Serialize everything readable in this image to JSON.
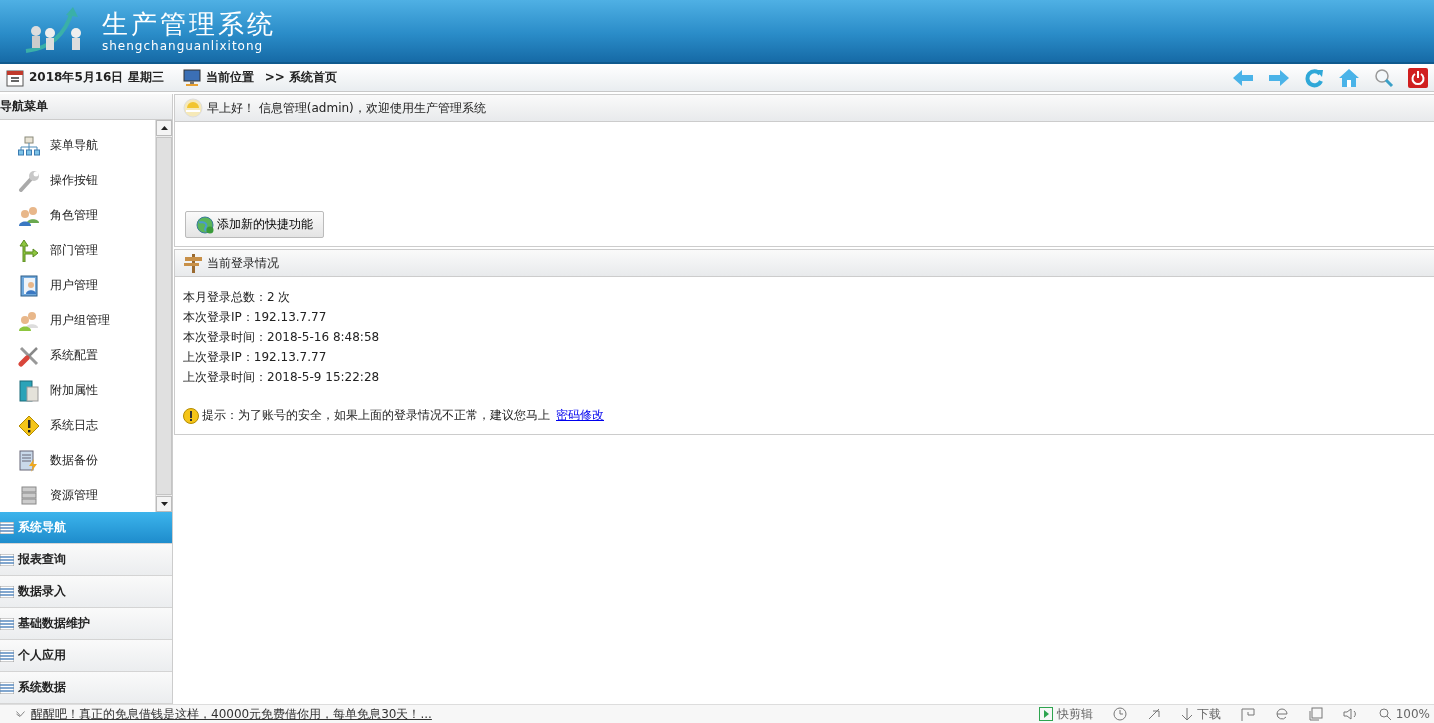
{
  "header": {
    "title": "生产管理系统",
    "subtitle": "shengchanguanlixitong"
  },
  "toolbar": {
    "date": "2018年5月16日 星期三",
    "location_label": "当前位置",
    "breadcrumb": ">> 系统首页"
  },
  "sidebar": {
    "title": "导航菜单",
    "menu_items": [
      {
        "label": "菜单导航"
      },
      {
        "label": "操作按钮"
      },
      {
        "label": "角色管理"
      },
      {
        "label": "部门管理"
      },
      {
        "label": "用户管理"
      },
      {
        "label": "用户组管理"
      },
      {
        "label": "系统配置"
      },
      {
        "label": "附加属性"
      },
      {
        "label": "系统日志"
      },
      {
        "label": "数据备份"
      },
      {
        "label": "资源管理"
      }
    ],
    "sections": [
      {
        "label": "系统导航",
        "selected": true
      },
      {
        "label": "报表查询",
        "selected": false
      },
      {
        "label": "数据录入",
        "selected": false
      },
      {
        "label": "基础数据维护",
        "selected": false
      },
      {
        "label": "个人应用",
        "selected": false
      },
      {
        "label": "系统数据",
        "selected": false
      }
    ]
  },
  "welcome_panel": {
    "greeting": "早上好！ 信息管理(admin)，欢迎使用生产管理系统",
    "add_button": "添加新的快捷功能"
  },
  "login_panel": {
    "title": "当前登录情况",
    "lines": [
      "本月登录总数：2 次",
      "本次登录IP：192.13.7.77",
      "本次登录时间：2018-5-16 8:48:58",
      "上次登录IP：192.13.7.77",
      "上次登录时间：2018-5-9 15:22:28"
    ],
    "tip": "提示：为了账号的安全，如果上面的登录情况不正常，建议您马上",
    "tip_link": "密码修改"
  },
  "status_bar": {
    "news": "醒醒吧！真正的免息借钱是这样，40000元免费借你用，每单免息30天！...",
    "clip": "快剪辑",
    "download": "下载",
    "zoom": "100%"
  }
}
